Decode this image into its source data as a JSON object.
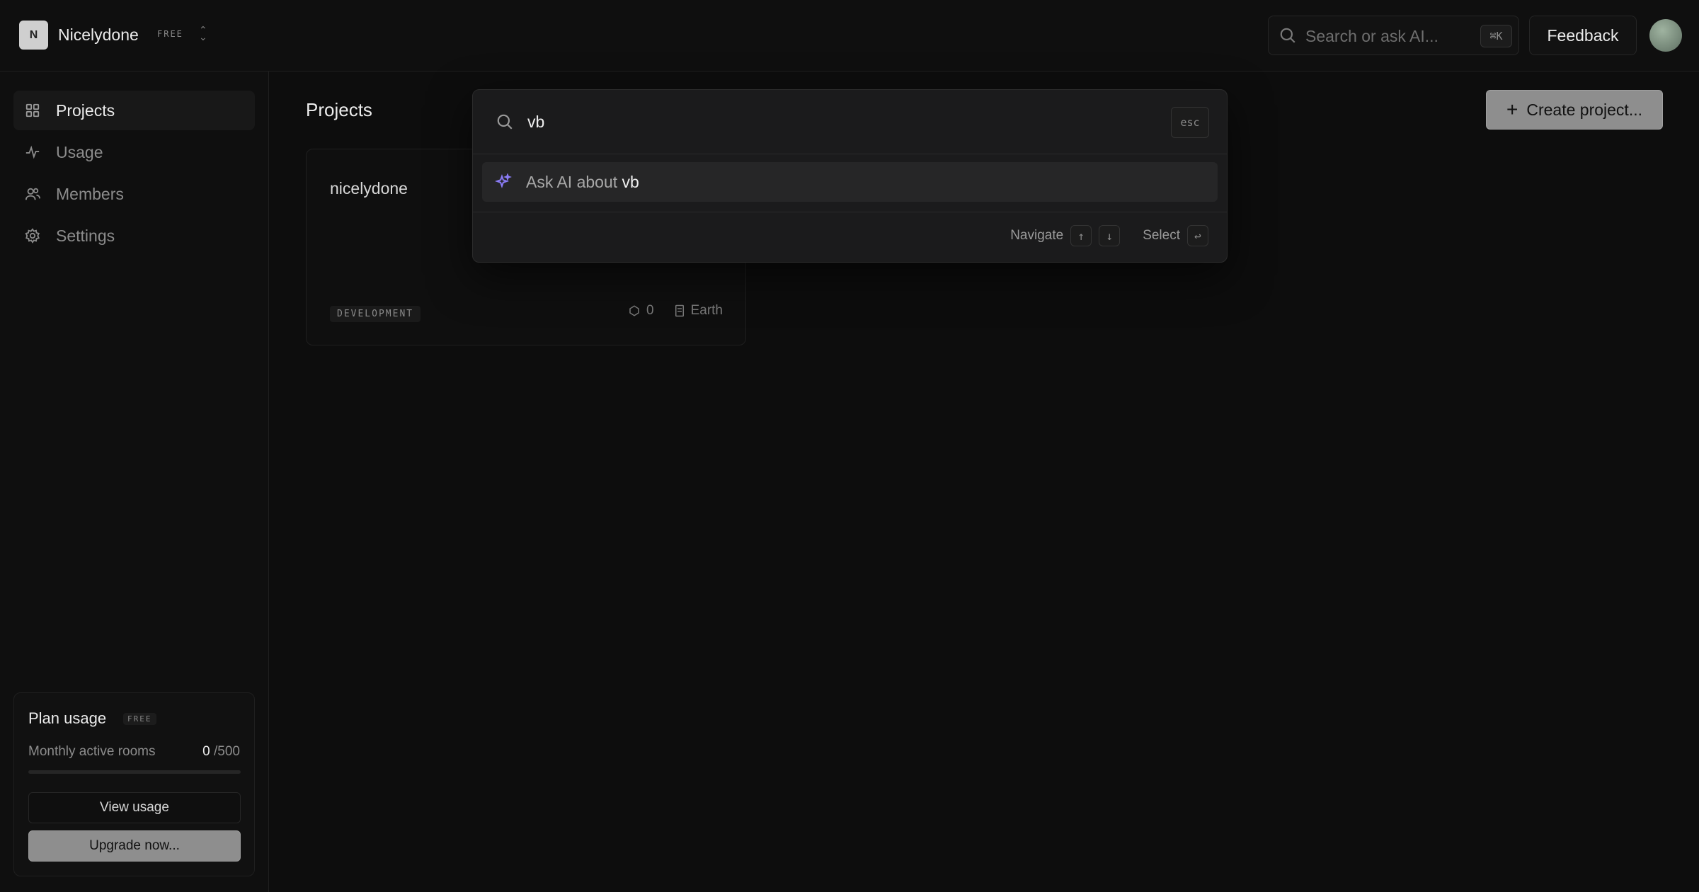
{
  "org": {
    "initial": "N",
    "name": "Nicelydone",
    "plan": "FREE",
    "switch_icon": "chevron-updown-icon"
  },
  "header": {
    "search_placeholder": "Search or ask AI...",
    "search_shortcut": "⌘K",
    "feedback_label": "Feedback"
  },
  "sidebar": {
    "items": [
      {
        "label": "Projects",
        "icon": "grid-icon",
        "active": true
      },
      {
        "label": "Usage",
        "icon": "activity-icon",
        "active": false
      },
      {
        "label": "Members",
        "icon": "users-icon",
        "active": false
      },
      {
        "label": "Settings",
        "icon": "gear-icon",
        "active": false
      }
    ],
    "plan_usage": {
      "title": "Plan usage",
      "badge": "FREE",
      "metric_label": "Monthly active rooms",
      "used": "0",
      "limit": "/500",
      "progress": 0,
      "view_usage_label": "View usage",
      "upgrade_label": "Upgrade now..."
    }
  },
  "main": {
    "title": "Projects",
    "create_button_label": "Create project...",
    "projects": [
      {
        "name": "nicelydone",
        "environment": "DEVELOPMENT",
        "rooms": "0",
        "region": "Earth"
      }
    ]
  },
  "command_palette": {
    "query": "vb",
    "esc_label": "esc",
    "result_prefix": "Ask AI about",
    "result_query": "vb",
    "navigate_label": "Navigate",
    "up_key": "↑",
    "down_key": "↓",
    "select_label": "Select",
    "enter_key": "↩"
  },
  "colors": {
    "background": "#0d0d0d",
    "accent_ai": "#8b7cf6",
    "button_gray": "#8e8e8e"
  }
}
